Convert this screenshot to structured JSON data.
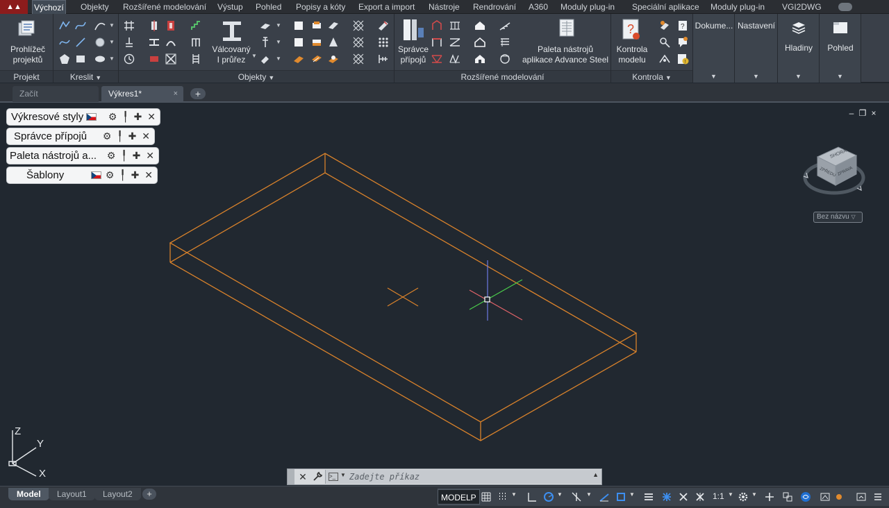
{
  "ribbon": {
    "tabs": [
      "Výchozí",
      "Objekty",
      "Rozšířené modelování",
      "Výstup",
      "Pohled",
      "Popisy a kóty",
      "Export a import",
      "Nástroje",
      "Rendrování",
      "A360",
      "Moduly plug-in",
      "Speciální aplikace",
      "Moduly plug-in",
      "VGI2DWG"
    ],
    "active_tab": "Výchozí",
    "panels": {
      "projekt": {
        "title": "Projekt",
        "button_line1": "Prohlížeč",
        "button_line2": "projektů"
      },
      "kreslit": {
        "title": "Kreslit"
      },
      "objekty": {
        "title": "Objekty",
        "button_line1": "Válcovaný",
        "button_line2": "I průřez"
      },
      "rozsirene": {
        "title": "Rozšířené modelování",
        "button1_line1": "Správce",
        "button1_line2": "přípojů",
        "button2_line1": "Paleta nástrojů",
        "button2_line2": "aplikace Advance Steel"
      },
      "kontrola": {
        "title": "Kontrola",
        "button_line1": "Kontrola",
        "button_line2": "modelu"
      },
      "dokumentace": {
        "title": "Dokume..."
      },
      "nastaveni": {
        "title": "Nastavení"
      },
      "hladiny": {
        "label": "Hladiny"
      },
      "pohled": {
        "label": "Pohled"
      }
    }
  },
  "doc_tabs": {
    "start": "Začít",
    "drawing": "Výkres1*",
    "close_glyph": "×",
    "new_glyph": "+"
  },
  "viewport": {
    "controls": [
      "–",
      "❐",
      "×"
    ],
    "palettes": [
      {
        "title": "Výkresové styly",
        "flag": true
      },
      {
        "title": "Správce přípojů",
        "flag": false
      },
      {
        "title": "Paleta nástrojů a...",
        "flag": false
      },
      {
        "title": "Šablony",
        "flag": true
      }
    ],
    "palette_tools": "⚙ ╿ ✚ ✕",
    "viewcube_label": "Bez názvu",
    "viewcube_faces": {
      "top": "SHORA",
      "front": "ZPŘEDU",
      "right": "ZPRAVA"
    },
    "ucs": {
      "x": "X",
      "y": "Y",
      "z": "Z"
    }
  },
  "command_line": {
    "placeholder": "Zadejte příkaz",
    "close_glyph": "✕",
    "prompt_glyph": ">_"
  },
  "status_bar": {
    "layouts": [
      "Model",
      "Layout1",
      "Layout2"
    ],
    "active_layout": "Model",
    "layout_add": "+",
    "modelp": "MODELP",
    "scale": "1:1"
  },
  "colors": {
    "background": "#212830",
    "model_lines": "#d9822b",
    "ribbon": "#3a4049",
    "axis_x": "#e3646a",
    "axis_y": "#4bcf4b",
    "axis_z": "#6e79e6"
  }
}
